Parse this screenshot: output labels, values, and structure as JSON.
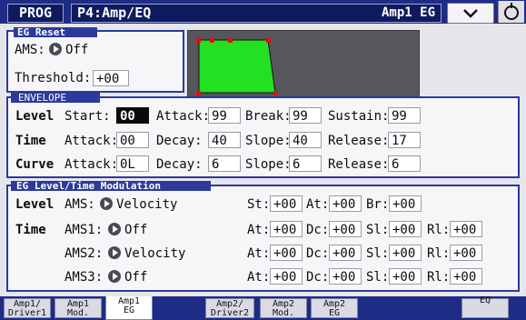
{
  "header": {
    "mode": "PROG",
    "title": "P4:Amp/EQ",
    "subtitle": "Amp1 EG"
  },
  "eg_reset": {
    "section": "EG Reset",
    "ams_label": "AMS:",
    "ams_value": "Off",
    "threshold_label": "Threshold:",
    "threshold_value": "+00"
  },
  "envelope": {
    "section": "ENVELOPE",
    "level": {
      "row": "Level",
      "start_label": "Start:",
      "start": "00",
      "attack_label": "Attack:",
      "attack": "99",
      "break_label": "Break:",
      "break": "99",
      "sustain_label": "Sustain:",
      "sustain": "99"
    },
    "time": {
      "row": "Time",
      "attack_label": "Attack:",
      "attack": "00",
      "decay_label": "Decay:",
      "decay": "40",
      "slope_label": "Slope:",
      "slope": "40",
      "release_label": "Release:",
      "release": "17"
    },
    "curve": {
      "row": "Curve",
      "attack_label": "Attack:",
      "attack": "0L",
      "decay_label": "Decay:",
      "decay": "6",
      "slope_label": "Slope:",
      "slope": "6",
      "release_label": "Release:",
      "release": "6"
    }
  },
  "modulation": {
    "section": "EG Level/Time Modulation",
    "level": {
      "row": "Level",
      "ams_label": "AMS:",
      "ams": "Velocity",
      "st_label": "St:",
      "st": "+00",
      "at_label": "At:",
      "at": "+00",
      "br_label": "Br:",
      "br": "+00"
    },
    "time": [
      {
        "row": "Time",
        "ams_label": "AMS1:",
        "ams": "Off",
        "at": "+00",
        "dc": "+00",
        "sl": "+00",
        "rl": "+00"
      },
      {
        "row": "",
        "ams_label": "AMS2:",
        "ams": "Velocity",
        "at": "+00",
        "dc": "+00",
        "sl": "+00",
        "rl": "+00"
      },
      {
        "row": "",
        "ams_label": "AMS3:",
        "ams": "Off",
        "at": "+00",
        "dc": "+00",
        "sl": "+00",
        "rl": "+00"
      }
    ],
    "labels": {
      "at": "At:",
      "dc": "Dc:",
      "sl": "Sl:",
      "rl": "Rl:"
    }
  },
  "tabs": [
    {
      "l1": "Amp1/",
      "l2": "Driver1"
    },
    {
      "l1": "Amp1",
      "l2": "Mod."
    },
    {
      "l1": "Amp1",
      "l2": "EG"
    },
    {
      "l1": "Amp2/",
      "l2": "Driver2"
    },
    {
      "l1": "Amp2",
      "l2": "Mod."
    },
    {
      "l1": "Amp2",
      "l2": "EG"
    },
    {
      "l1": "",
      "l2": "EQ"
    }
  ],
  "colors": {
    "accent": "#1e2c86",
    "graph_fill": "#22e022",
    "graph_point": "#e01010"
  },
  "icons": {
    "dropdown": "chevron-down-icon",
    "corner": "circle-icon",
    "selector": "arrow-right-icon"
  }
}
